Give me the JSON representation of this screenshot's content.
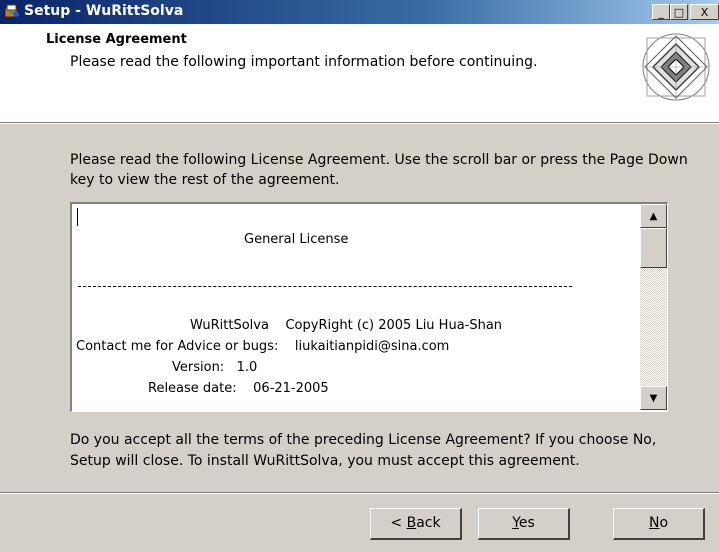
{
  "window": {
    "title": "Setup - WuRittSolva",
    "controls": [
      "_",
      "□",
      "X"
    ]
  },
  "header": {
    "title": "License Agreement",
    "subtitle": "Please read the following important information before continuing."
  },
  "intro": "Please read the following License Agreement. Use the scroll bar or press the Page Down key to view the rest of the agreement.",
  "license": {
    "heading": "General License",
    "copyright": "WuRittSolva    CopyRight (c) 2005 Liu Hua-Shan",
    "contact": "Contact me for Advice or bugs:    liukaitianpidi@sina.com",
    "version": "Version:   1.0",
    "release": "Release date:    06-21-2005"
  },
  "question": "Do you accept all the terms of the preceding License Agreement? If you choose No, Setup will close. To install WuRittSolva, you must accept this agreement.",
  "buttons": {
    "back_prefix": "< ",
    "back_mnemonic": "B",
    "back_rest": "ack",
    "yes_mnemonic": "Y",
    "yes_rest": "es",
    "no_mnemonic": "N",
    "no_rest": "o"
  },
  "icons": {
    "app": "setup-installer-icon",
    "logo": "diamond-logo-icon"
  }
}
